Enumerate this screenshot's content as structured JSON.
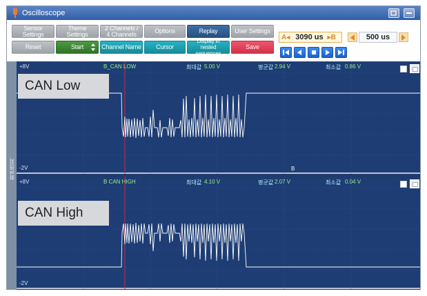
{
  "window": {
    "title": "Oscilloscope"
  },
  "toolbar": {
    "row1": [
      "Sensor Settings",
      "Theme Settings",
      "2 Channels /\n4 Channels",
      "Options",
      "Replay",
      "User Settings"
    ],
    "reset_label": "Reset",
    "start_label": "Start",
    "channel_name_label": "Channel Name",
    "cursor_label": "Cursor",
    "display_nested_label": "Display in\nnested sequences",
    "save_label": "Save"
  },
  "cursor_readout": {
    "a_marker": "A◂",
    "value": "3090 us",
    "b_marker": "▸B"
  },
  "time_div": {
    "value": "500 us"
  },
  "channels": [
    {
      "label": "CAN Low",
      "id": "B_CAN LOW",
      "max_label": "최대값",
      "max_value": "5.00 V",
      "avg_label": "평균값",
      "avg_value": "2.94 V",
      "min_label": "최소값",
      "min_value": "0.86 V",
      "vmax": "+8V",
      "vmin": "-2V",
      "cursor_b": "B"
    },
    {
      "label": "CAN High",
      "id": "B CAN HIGH",
      "max_label": "최대값",
      "max_value": "4.10 V",
      "avg_label": "평균값",
      "avg_value": "2.07 V",
      "min_label": "최소값",
      "min_value": "0.04 V",
      "vmax": "+8V",
      "vmin": "-2V"
    }
  ],
  "side_label": "화면캡쳐",
  "colors": {
    "scope_bg": "#1e3d74",
    "trace": "#ffffff",
    "info_text": "#9cf27e",
    "cursor_line": "#c0304a"
  }
}
